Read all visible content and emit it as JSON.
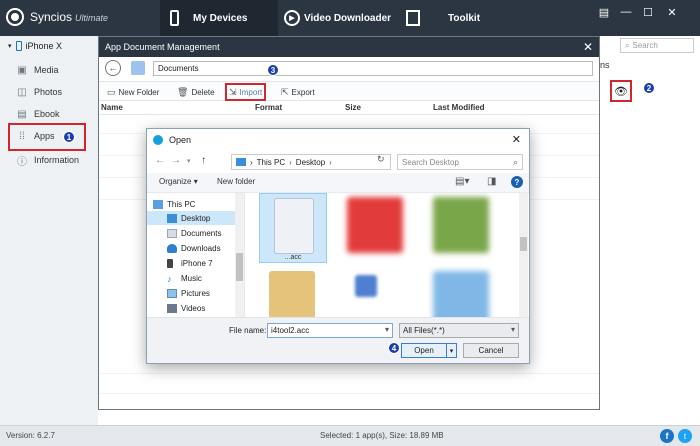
{
  "app": {
    "name": "Syncios",
    "edition": "Ultimate"
  },
  "tabs": [
    {
      "label": "My Devices",
      "icon": "phone-icon"
    },
    {
      "label": "Video Downloader",
      "icon": "play-icon"
    },
    {
      "label": "Toolkit",
      "icon": "toolkit-icon"
    }
  ],
  "window_controls": [
    "▤",
    "—",
    "☐",
    "✕"
  ],
  "sidebar": {
    "device": "iPhone X",
    "items": [
      {
        "label": "Media",
        "icon": "media-icon"
      },
      {
        "label": "Photos",
        "icon": "photos-icon"
      },
      {
        "label": "Ebook",
        "icon": "ebook-icon"
      },
      {
        "label": "Apps",
        "icon": "apps-icon",
        "active": true
      },
      {
        "label": "Information",
        "icon": "info-icon"
      }
    ]
  },
  "main": {
    "search_placeholder": "Search",
    "column_fragment": "ns"
  },
  "adm": {
    "title": "App Document Management",
    "path": "Documents",
    "toolbar": {
      "new_folder": "New Folder",
      "delete": "Delete",
      "import": "Import",
      "export": "Export"
    },
    "columns": [
      "Name",
      "Format",
      "Size",
      "Last Modified"
    ]
  },
  "open_dialog": {
    "title": "Open",
    "breadcrumb": [
      "This PC",
      "Desktop"
    ],
    "search_placeholder": "Search Desktop",
    "organize": "Organize",
    "new_folder": "New folder",
    "tree": [
      {
        "label": "This PC",
        "icon": "pc-icon"
      },
      {
        "label": "Desktop",
        "icon": "desktop-icon",
        "selected": true
      },
      {
        "label": "Documents",
        "icon": "documents-icon"
      },
      {
        "label": "Downloads",
        "icon": "downloads-icon"
      },
      {
        "label": "iPhone 7",
        "icon": "phone-icon"
      },
      {
        "label": "Music",
        "icon": "music-icon"
      },
      {
        "label": "Pictures",
        "icon": "pictures-icon"
      },
      {
        "label": "Videos",
        "icon": "videos-icon"
      }
    ],
    "files": [
      {
        "label": "...acc",
        "color": "#eef2f7",
        "selected": true
      },
      {
        "label": "",
        "color": "#e23b3b"
      },
      {
        "label": "",
        "color": "#7aa64a"
      },
      {
        "label": "",
        "color": "#e6c37a"
      },
      {
        "label": "",
        "color": "#4f7fd0"
      },
      {
        "label": "",
        "color": "#7fb8e6"
      }
    ],
    "file_name_label": "File name:",
    "file_name_value": "i4tool2.acc",
    "filter": "All Files(*.*)",
    "open": "Open",
    "cancel": "Cancel"
  },
  "status": {
    "version": "Version: 6.2.7",
    "selection": "Selected: 1 app(s), Size: 18.89 MB"
  },
  "annotations": {
    "badge1": "1",
    "badge2": "2",
    "badge3": "3",
    "badge4": "4"
  },
  "colors": {
    "topbar": "#2b3642",
    "highlight": "#d0262e",
    "badge": "#1a3fa8"
  }
}
